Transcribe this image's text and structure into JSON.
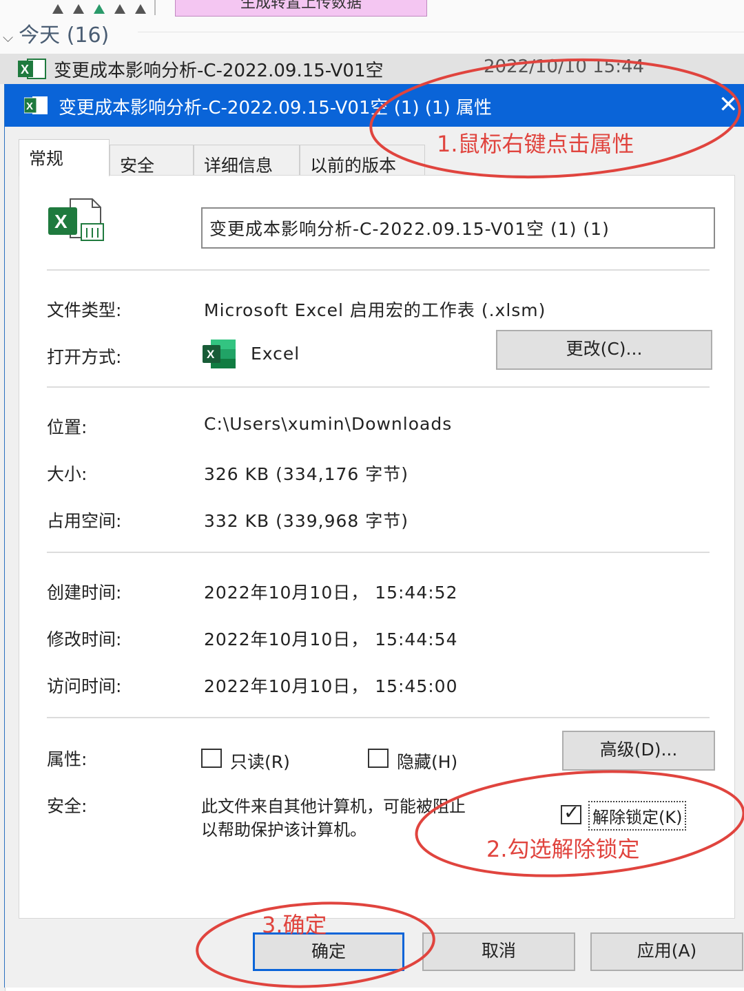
{
  "background": {
    "pink_label": "生成转置上传数据",
    "group_label": "今天 (16)",
    "file_row": {
      "name": "变更成本影响分析-C-2022.09.15-V01空",
      "time": "2022/10/10 15:44"
    }
  },
  "dialog": {
    "title": "变更成本影响分析-C-2022.09.15-V01空 (1) (1) 属性",
    "close_glyph": "✕",
    "tabs": [
      "常规",
      "安全",
      "详细信息",
      "以前的版本"
    ],
    "file_name": "变更成本影响分析-C-2022.09.15-V01空 (1) (1)",
    "fields": {
      "file_type": {
        "label": "文件类型:",
        "value": "Microsoft Excel 启用宏的工作表 (.xlsm)"
      },
      "open_with": {
        "label": "打开方式:",
        "value": "Excel",
        "change_button": "更改(C)..."
      },
      "location": {
        "label": "位置:",
        "value": "C:\\Users\\xumin\\Downloads"
      },
      "size": {
        "label": "大小:",
        "value": "326 KB (334,176 字节)"
      },
      "size_on_disk": {
        "label": "占用空间:",
        "value": "332 KB (339,968 字节)"
      },
      "created": {
        "label": "创建时间:",
        "value": "2022年10月10日， 15:44:52"
      },
      "modified": {
        "label": "修改时间:",
        "value": "2022年10月10日， 15:44:54"
      },
      "accessed": {
        "label": "访问时间:",
        "value": "2022年10月10日， 15:45:00"
      }
    },
    "attributes": {
      "label": "属性:",
      "readonly": {
        "label": "只读(R)",
        "checked": false
      },
      "hidden": {
        "label": "隐藏(H)",
        "checked": false
      },
      "advanced_button": "高级(D)..."
    },
    "security": {
      "label": "安全:",
      "text_line1": "此文件来自其他计算机，可能被阻止",
      "text_line2": "以帮助保护该计算机。",
      "unblock": {
        "label": "解除锁定(K)",
        "checked": true
      }
    },
    "buttons": {
      "ok": "确定",
      "cancel": "取消",
      "apply": "应用(A)"
    }
  },
  "annotations": {
    "step1": "1.鼠标右键点击属性",
    "step2": "2.勾选解除锁定",
    "step3": "3.确定",
    "color": "#e0443e"
  },
  "colors": {
    "titlebar": "#0a64d8",
    "excel_green": "#1f7a3e",
    "pink": "#f4c6f2"
  }
}
